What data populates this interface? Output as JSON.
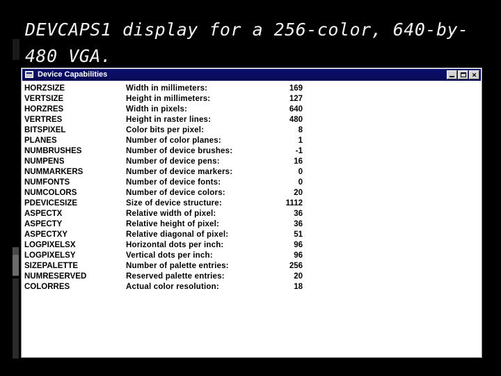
{
  "slide": {
    "title": "DEVCAPS1 display for a 256-color, 640-by-480 VGA."
  },
  "window": {
    "title": "Device Capabilities",
    "minimize_label": "",
    "maximize_label": "",
    "close_label": "×"
  },
  "capabilities": [
    {
      "name": "HORZSIZE",
      "description": "Width in millimeters:",
      "value": "169"
    },
    {
      "name": "VERTSIZE",
      "description": "Height in millimeters:",
      "value": "127"
    },
    {
      "name": "HORZRES",
      "description": "Width in pixels:",
      "value": "640"
    },
    {
      "name": "VERTRES",
      "description": "Height in raster lines:",
      "value": "480"
    },
    {
      "name": "BITSPIXEL",
      "description": "Color bits per pixel:",
      "value": "8"
    },
    {
      "name": "PLANES",
      "description": "Number of color planes:",
      "value": "1"
    },
    {
      "name": "NUMBRUSHES",
      "description": "Number of device brushes:",
      "value": "-1"
    },
    {
      "name": "NUMPENS",
      "description": "Number of device pens:",
      "value": "16"
    },
    {
      "name": "NUMMARKERS",
      "description": "Number of device markers:",
      "value": "0"
    },
    {
      "name": "NUMFONTS",
      "description": "Number of device fonts:",
      "value": "0"
    },
    {
      "name": "NUMCOLORS",
      "description": "Number of device colors:",
      "value": "20"
    },
    {
      "name": "PDEVICESIZE",
      "description": "Size of device structure:",
      "value": "1112"
    },
    {
      "name": "ASPECTX",
      "description": "Relative width of pixel:",
      "value": "36"
    },
    {
      "name": "ASPECTY",
      "description": "Relative height of pixel:",
      "value": "36"
    },
    {
      "name": "ASPECTXY",
      "description": "Relative diagonal of pixel:",
      "value": "51"
    },
    {
      "name": "LOGPIXELSX",
      "description": "Horizontal dots per inch:",
      "value": "96"
    },
    {
      "name": "LOGPIXELSY",
      "description": "Vertical dots per inch:",
      "value": "96"
    },
    {
      "name": "SIZEPALETTE",
      "description": "Number of palette entries:",
      "value": "256"
    },
    {
      "name": "NUMRESERVED",
      "description": "Reserved palette entries:",
      "value": "20"
    },
    {
      "name": "COLORRES",
      "description": "Actual color resolution:",
      "value": "18"
    }
  ],
  "colors": {
    "background": "#000000",
    "titlebar": "#0c0f6e",
    "window": "#ffffff"
  },
  "icons": {
    "app": "device-capabilities-icon",
    "minimize": "minimize-icon",
    "maximize": "maximize-icon",
    "close": "close-icon"
  }
}
